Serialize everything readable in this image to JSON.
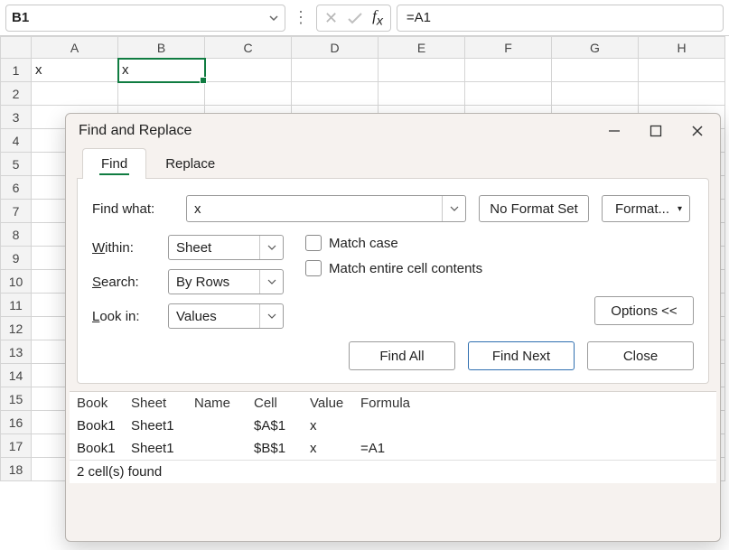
{
  "formula_bar": {
    "name_box": "B1",
    "formula": "=A1"
  },
  "grid": {
    "columns": [
      "A",
      "B",
      "C",
      "D",
      "E",
      "F",
      "G",
      "H"
    ],
    "rows": 18,
    "selected_cell": "B1",
    "cells": {
      "A1": "x",
      "B1": "x"
    }
  },
  "dialog": {
    "title": "Find and Replace",
    "tabs": {
      "find": "Find",
      "replace": "Replace"
    },
    "find_what_label": "Find what:",
    "find_what_value": "x",
    "no_format_label": "No Format Set",
    "format_label": "Format...",
    "within": {
      "label": "Within:",
      "value": "Sheet"
    },
    "search": {
      "label": "Search:",
      "value": "By Rows"
    },
    "lookin": {
      "label": "Look in:",
      "value": "Values"
    },
    "match_case": "Match case",
    "match_entire": "Match entire cell contents",
    "options_btn": "Options <<",
    "find_all": "Find All",
    "find_next": "Find Next",
    "close": "Close",
    "results": {
      "headers": [
        "Book",
        "Sheet",
        "Name",
        "Cell",
        "Value",
        "Formula"
      ],
      "rows": [
        {
          "book": "Book1",
          "sheet": "Sheet1",
          "name": "",
          "cell": "$A$1",
          "value": "x",
          "formula": ""
        },
        {
          "book": "Book1",
          "sheet": "Sheet1",
          "name": "",
          "cell": "$B$1",
          "value": "x",
          "formula": "=A1"
        }
      ]
    },
    "status": "2 cell(s) found"
  }
}
